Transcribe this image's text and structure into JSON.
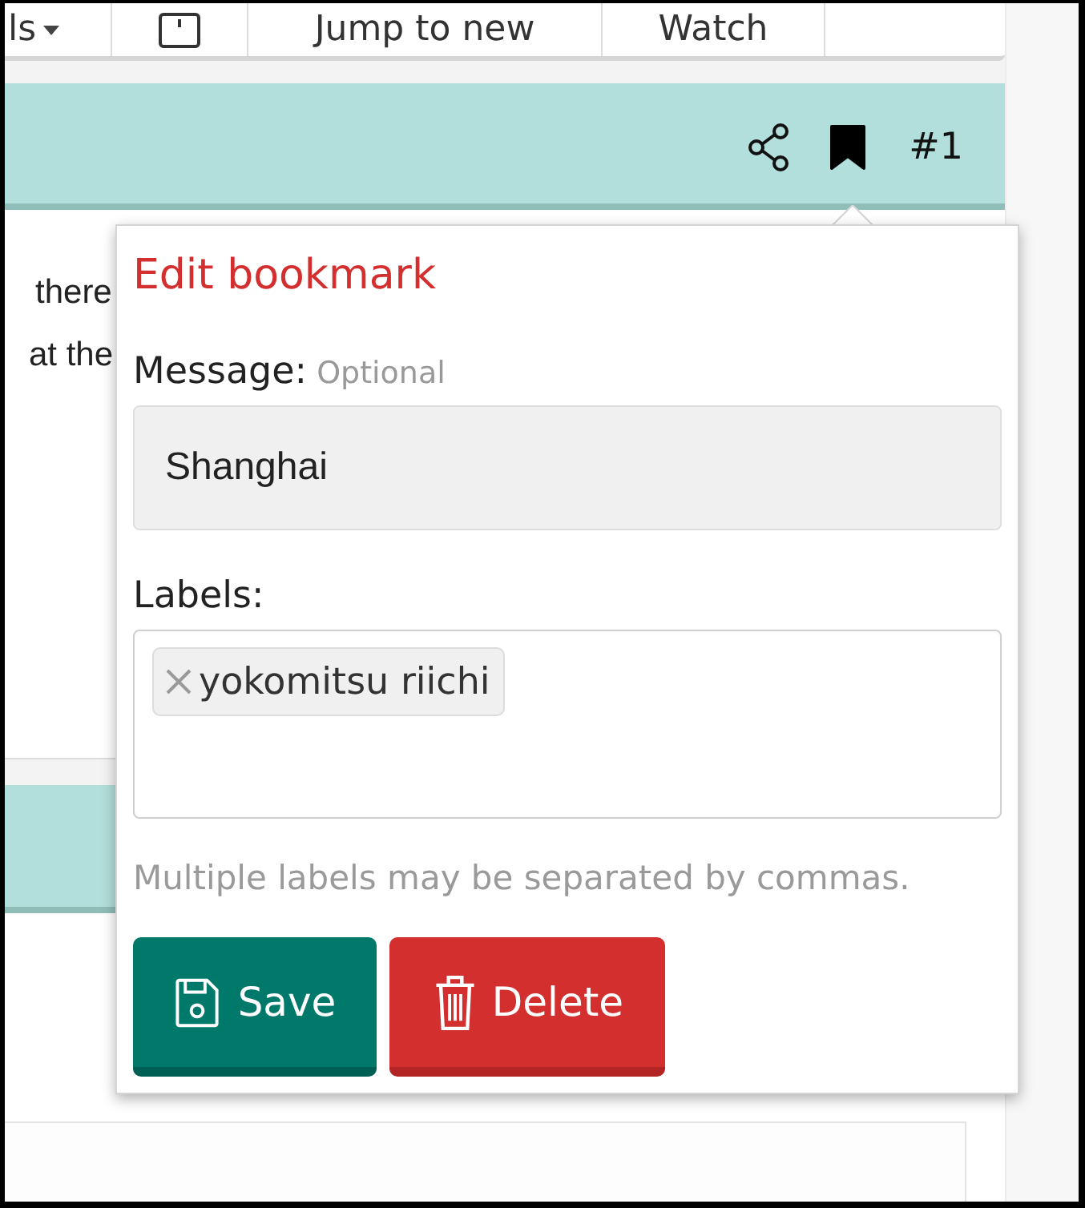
{
  "toolbar": {
    "items": [
      {
        "kind": "menu",
        "label": "ls"
      },
      {
        "kind": "icon"
      },
      {
        "kind": "button",
        "label": "Jump to new"
      },
      {
        "kind": "button",
        "label": "Watch"
      }
    ]
  },
  "post": {
    "number": "#1",
    "bookmarked": true,
    "text_lines": [
      "there",
      "at the"
    ]
  },
  "bookmark_popup": {
    "title": "Edit bookmark",
    "message_label": "Message:",
    "message_hint": "Optional",
    "message_value": "Shanghai",
    "labels_label": "Labels:",
    "labels": [
      {
        "text": "yokomitsu riichi"
      }
    ],
    "help": "Multiple labels may be separated by commas.",
    "buttons": [
      {
        "kind": "save",
        "label": "Save"
      },
      {
        "kind": "delete",
        "label": "Delete"
      }
    ]
  }
}
